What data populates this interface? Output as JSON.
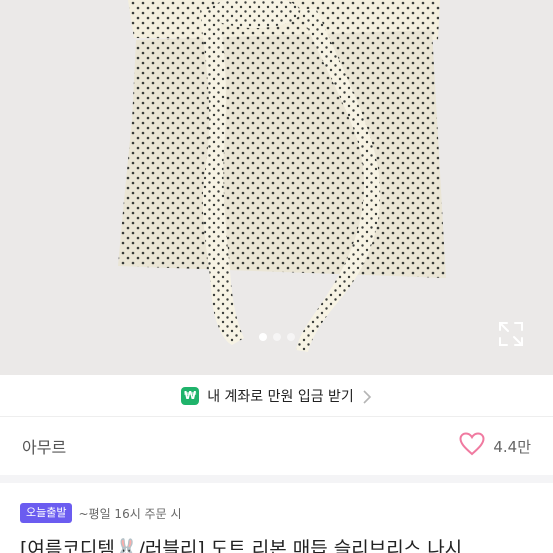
{
  "photo": {
    "alt_icon": "product-photo",
    "dots_total": 3,
    "dots_active_index": 0
  },
  "promo": {
    "badge_symbol": "₩",
    "text": "내 계좌로 만원 입금 받기",
    "badge_color": "#1fb36b"
  },
  "shop": {
    "name": "아무르",
    "likes": "4.4만",
    "heart_color": "#f07aa0"
  },
  "shipping": {
    "badge": "오늘출발",
    "badge_color": "#6b5cf0",
    "text": "~평일 16시 주문 시"
  },
  "product": {
    "title": "[여름코디템🐰/러블리] 도트 리본 매듭 슬리브리스 나시"
  }
}
